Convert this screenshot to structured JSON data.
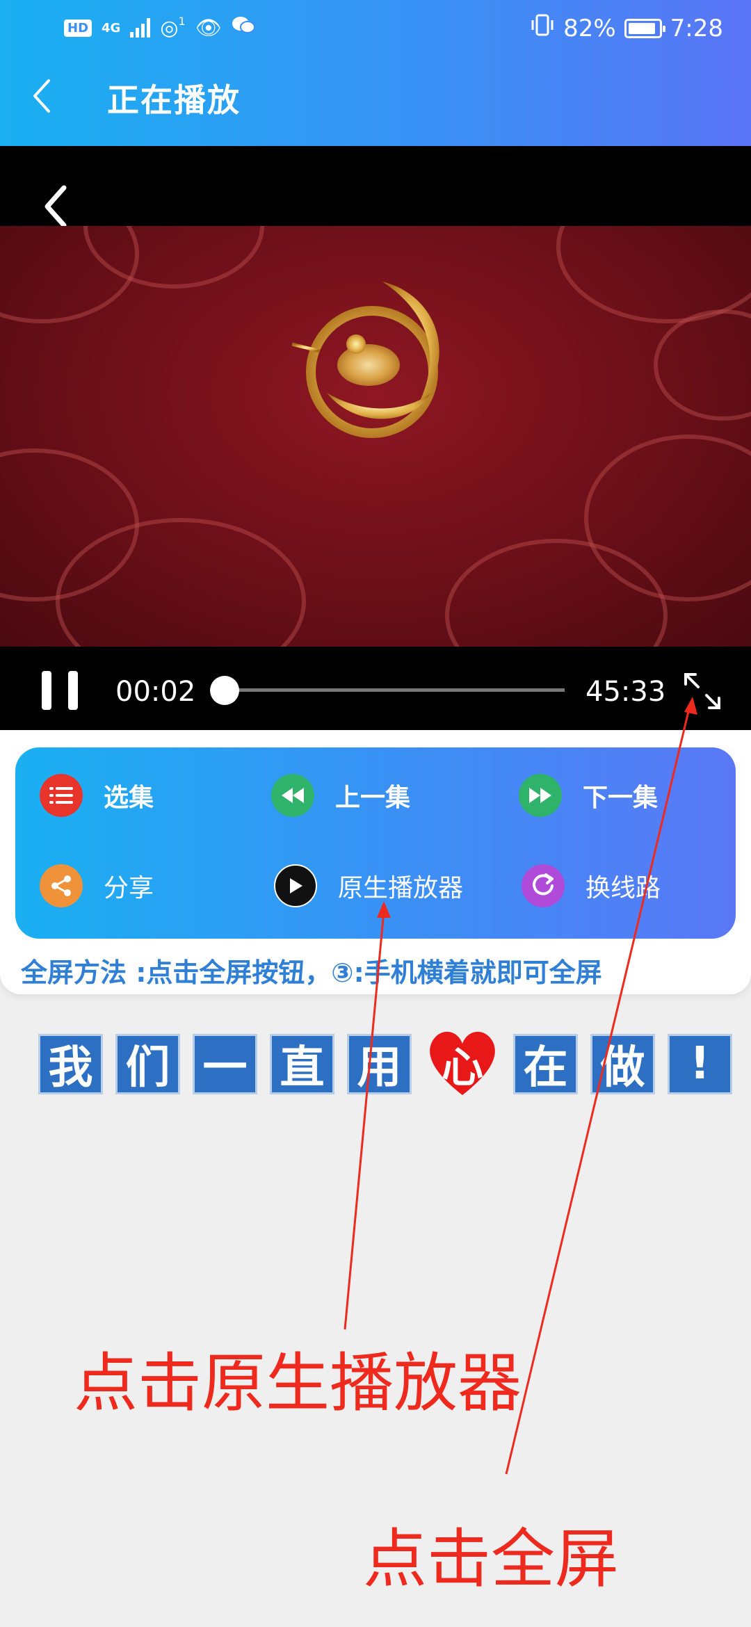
{
  "status_bar": {
    "hd": "HD",
    "network": "4G",
    "hotspot_count": "1",
    "battery": "82%",
    "time": "7:28",
    "icons": [
      "hd-icon",
      "signal-icon",
      "hotspot-icon",
      "eye-icon",
      "wechat-icon",
      "vibrate-icon",
      "battery-icon"
    ]
  },
  "header": {
    "title": "正在播放"
  },
  "player": {
    "current_time": "00:02",
    "total_time": "45:33",
    "progress": 0.001,
    "state": "playing"
  },
  "menu": {
    "items": [
      {
        "label": "选集",
        "icon": "list-icon",
        "color": "#e8352c"
      },
      {
        "label": "上一集",
        "icon": "previous-icon",
        "color": "#2fb36a"
      },
      {
        "label": "下一集",
        "icon": "next-icon",
        "color": "#2fb36a"
      },
      {
        "label": "分享",
        "icon": "share-icon",
        "color": "#f0923a"
      },
      {
        "label": "原生播放器",
        "icon": "play-icon",
        "color": "#111111"
      },
      {
        "label": "换线路",
        "icon": "refresh-icon",
        "color": "#b04ad8"
      }
    ]
  },
  "tip": "全屏方法  :点击全屏按钮，③:手机横着就即可全屏",
  "slogan": [
    "我",
    "们",
    "一",
    "直",
    "用",
    "心",
    "在",
    "做",
    "!"
  ],
  "annotations": {
    "native_player": "点击原生播放器",
    "fullscreen": "点击全屏"
  },
  "colors": {
    "header_gradient_start": "#1ab0f2",
    "header_gradient_end": "#5a75f6",
    "annotation_red": "#ee2a1e",
    "tip_blue": "#2f7fd6",
    "slogan_blue": "#2d6fc3"
  }
}
